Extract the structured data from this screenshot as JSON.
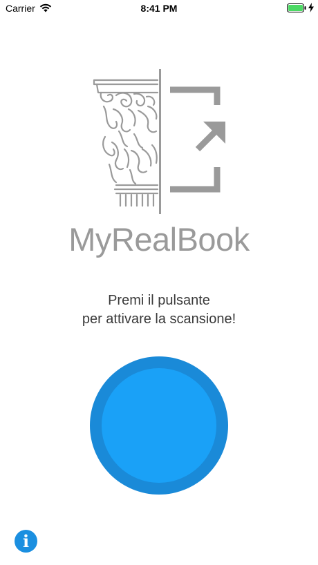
{
  "status_bar": {
    "carrier": "Carrier",
    "time": "8:41 PM",
    "battery_color": "#4cd964"
  },
  "logo": {
    "text": "MyRealBook",
    "color": "#9a9a9a",
    "icons": [
      "corinthian-capital-icon",
      "scan-bracket-arrow-icon"
    ]
  },
  "instruction": {
    "line1": "Premi il pulsante",
    "line2": "per attivare la scansione!"
  },
  "scan_button": {
    "outer_color": "#1a8ad8",
    "inner_color": "#1aa1f7"
  },
  "info_button": {
    "glyph": "i",
    "color": "#1b8fe0"
  }
}
